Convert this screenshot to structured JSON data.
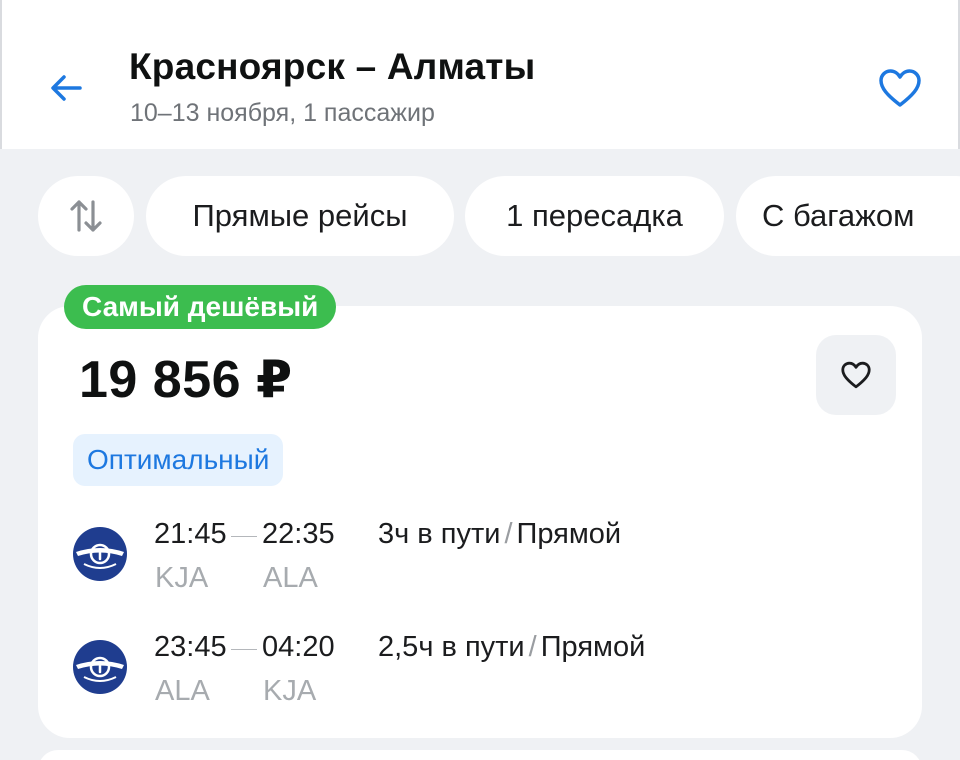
{
  "header": {
    "title": "Красноярск – Алматы",
    "subtitle": "10–13 ноября, 1 пассажир",
    "back_icon": "arrow-left-icon",
    "favorite_icon": "heart-outline-icon",
    "accent_color": "#1d78e0"
  },
  "filters": {
    "sort_icon": "sort-arrows-icon",
    "chips": [
      "Прямые рейсы",
      "1 пересадка",
      "С багажом"
    ]
  },
  "offer": {
    "badge": "Самый дешёвый",
    "badge_color": "#3cbd4f",
    "price": "19 856 ₽",
    "tag": "Оптимальный",
    "favorite_icon": "heart-outline-icon",
    "flights": [
      {
        "airline_logo": "aeroflot-logo-icon",
        "depart_time": "21:45",
        "arrive_time": "22:35",
        "duration": "3ч в пути",
        "sep": "/",
        "type": "Прямой",
        "depart_code": "KJA",
        "arrive_code": "ALA"
      },
      {
        "airline_logo": "aeroflot-logo-icon",
        "depart_time": "23:45",
        "arrive_time": "04:20",
        "duration": "2,5ч в пути",
        "sep": "/",
        "type": "Прямой",
        "depart_code": "ALA",
        "arrive_code": "KJA"
      }
    ]
  }
}
